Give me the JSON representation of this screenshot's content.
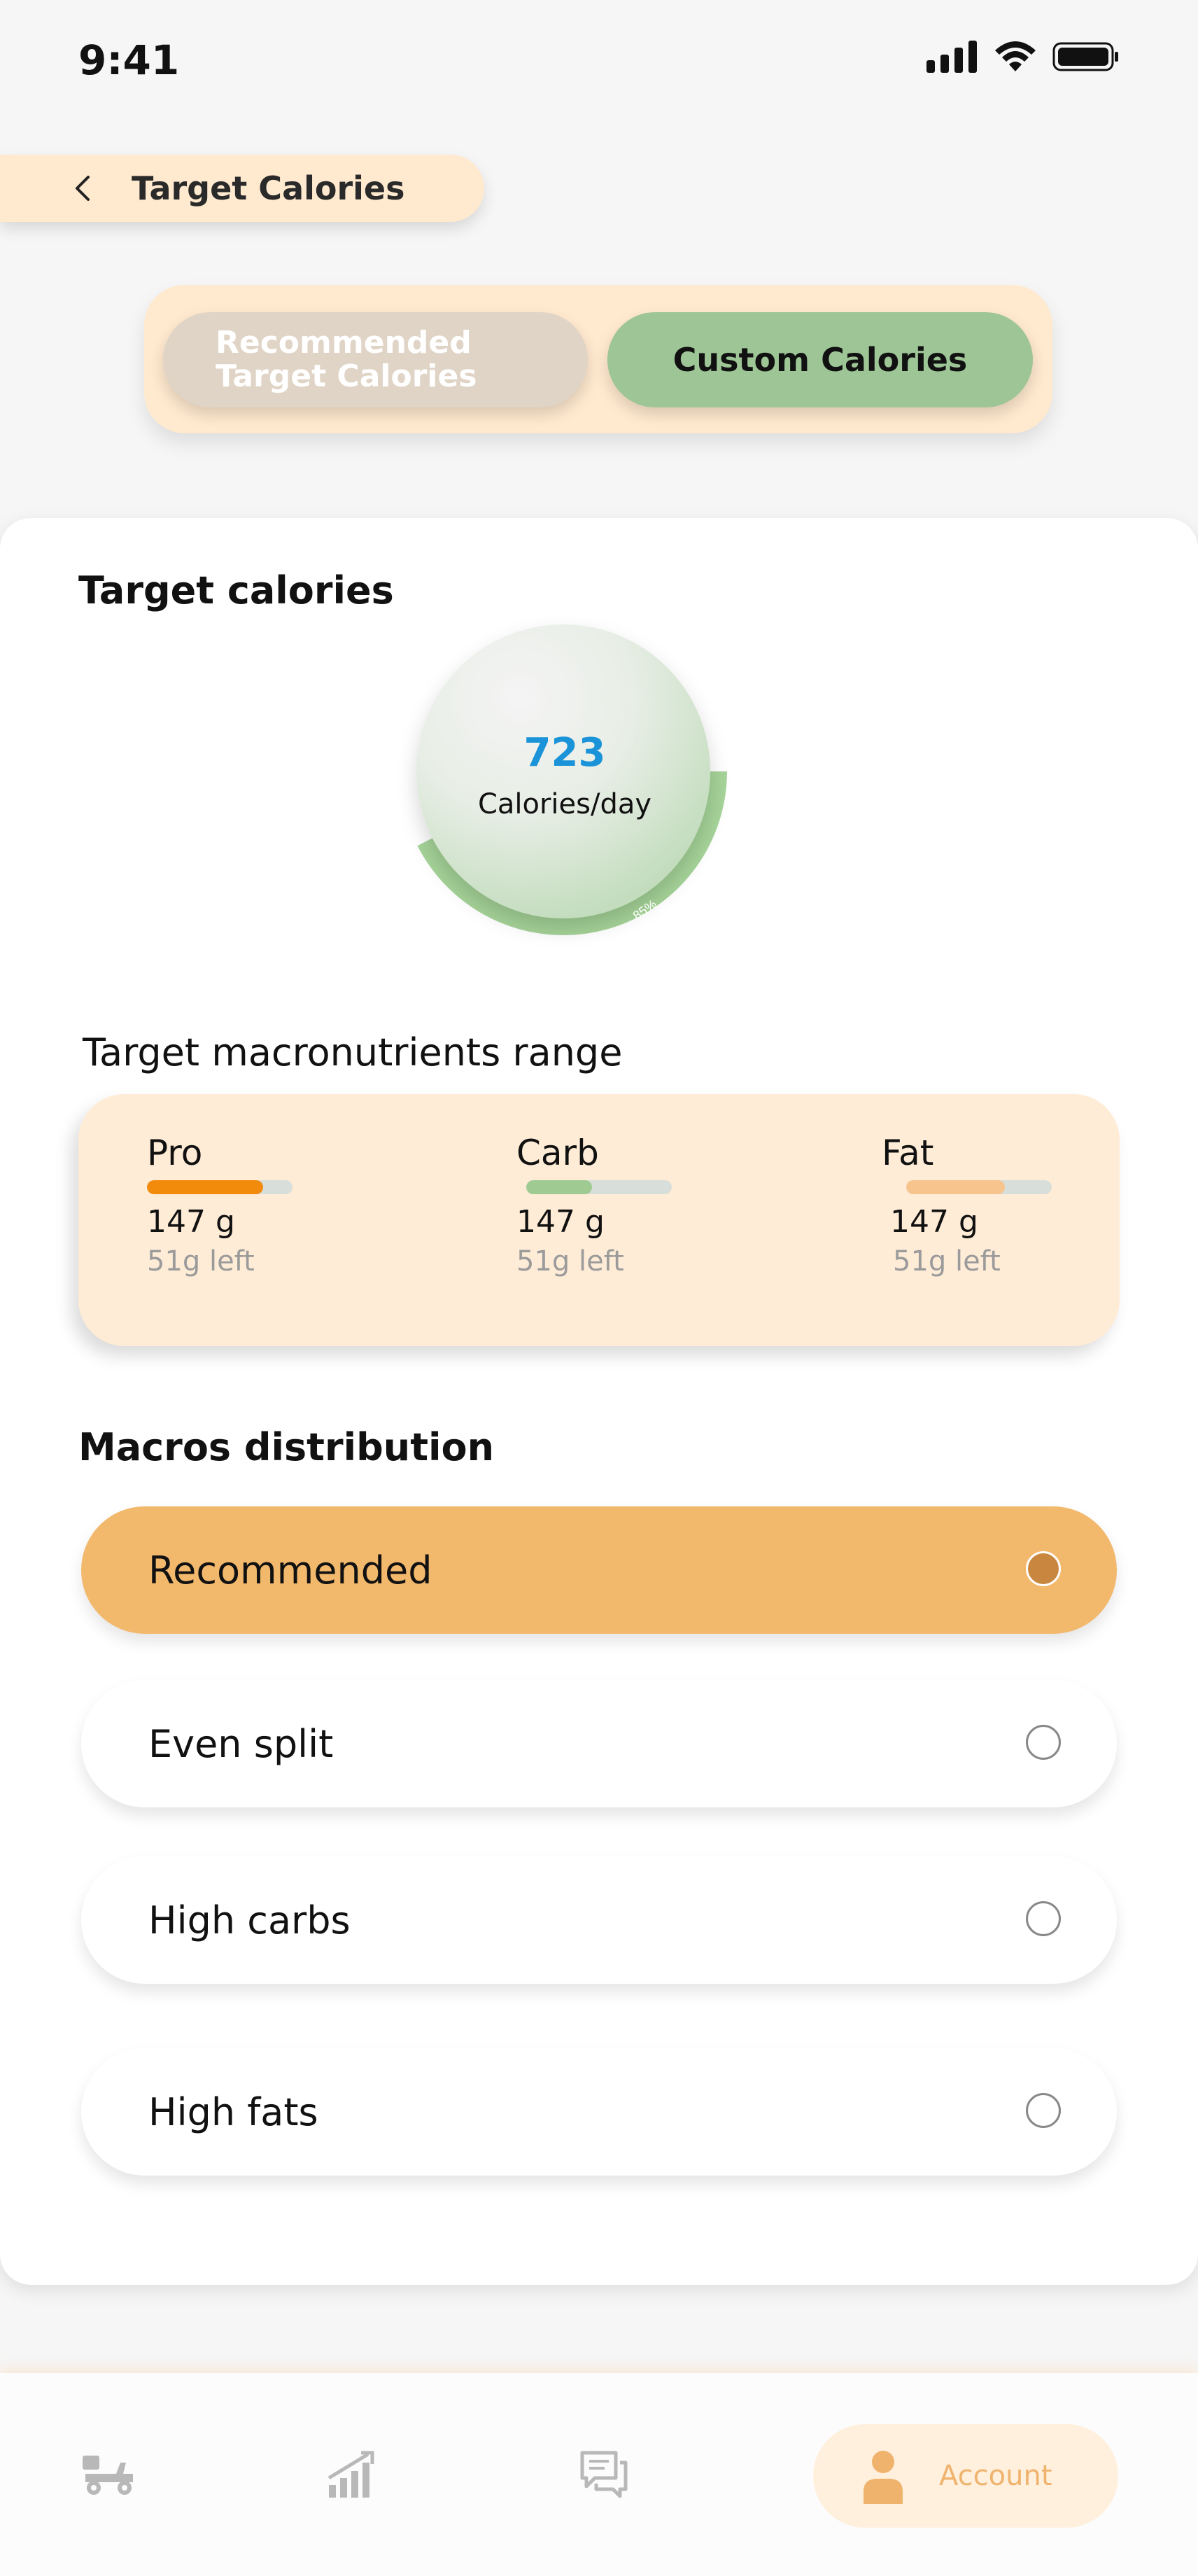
{
  "status_bar": {
    "time": "9:41"
  },
  "header": {
    "title": "Target Calories"
  },
  "tabs": {
    "recommended_label": "Recommended Target Calories",
    "custom_label": "Custom Calories",
    "active": "custom"
  },
  "target": {
    "title": "Target calories",
    "value": "723",
    "unit": "Calories/day",
    "progress_label": "85%",
    "progress_fraction": 0.85
  },
  "macros": {
    "title": "Target macronutrients range",
    "items": [
      {
        "name": "Pro",
        "grams": "147 g",
        "left": "51g left",
        "fill": 0.8,
        "color": "#f28b0c"
      },
      {
        "name": "Carb",
        "grams": "147 g",
        "left": "51g left",
        "fill": 0.45,
        "color": "#9fcb92"
      },
      {
        "name": "Fat",
        "grams": "147 g",
        "left": "51g left",
        "fill": 0.68,
        "color": "#f8c48d"
      }
    ]
  },
  "distribution": {
    "title": "Macros distribution",
    "options": [
      {
        "label": "Recommended",
        "selected": true
      },
      {
        "label": "Even split",
        "selected": false
      },
      {
        "label": "High carbs",
        "selected": false
      },
      {
        "label": "High fats",
        "selected": false
      }
    ]
  },
  "bottom_nav": {
    "items": [
      {
        "icon": "delivery-scooter-icon"
      },
      {
        "icon": "chart-icon"
      },
      {
        "icon": "chat-icon"
      },
      {
        "icon": "account-icon",
        "label": "Account",
        "active": true
      }
    ]
  },
  "colors": {
    "accent_orange": "#f2b86c",
    "accent_green": "#9dc596",
    "peach": "#ffe9cf",
    "calorie_blue": "#1b93d8"
  }
}
